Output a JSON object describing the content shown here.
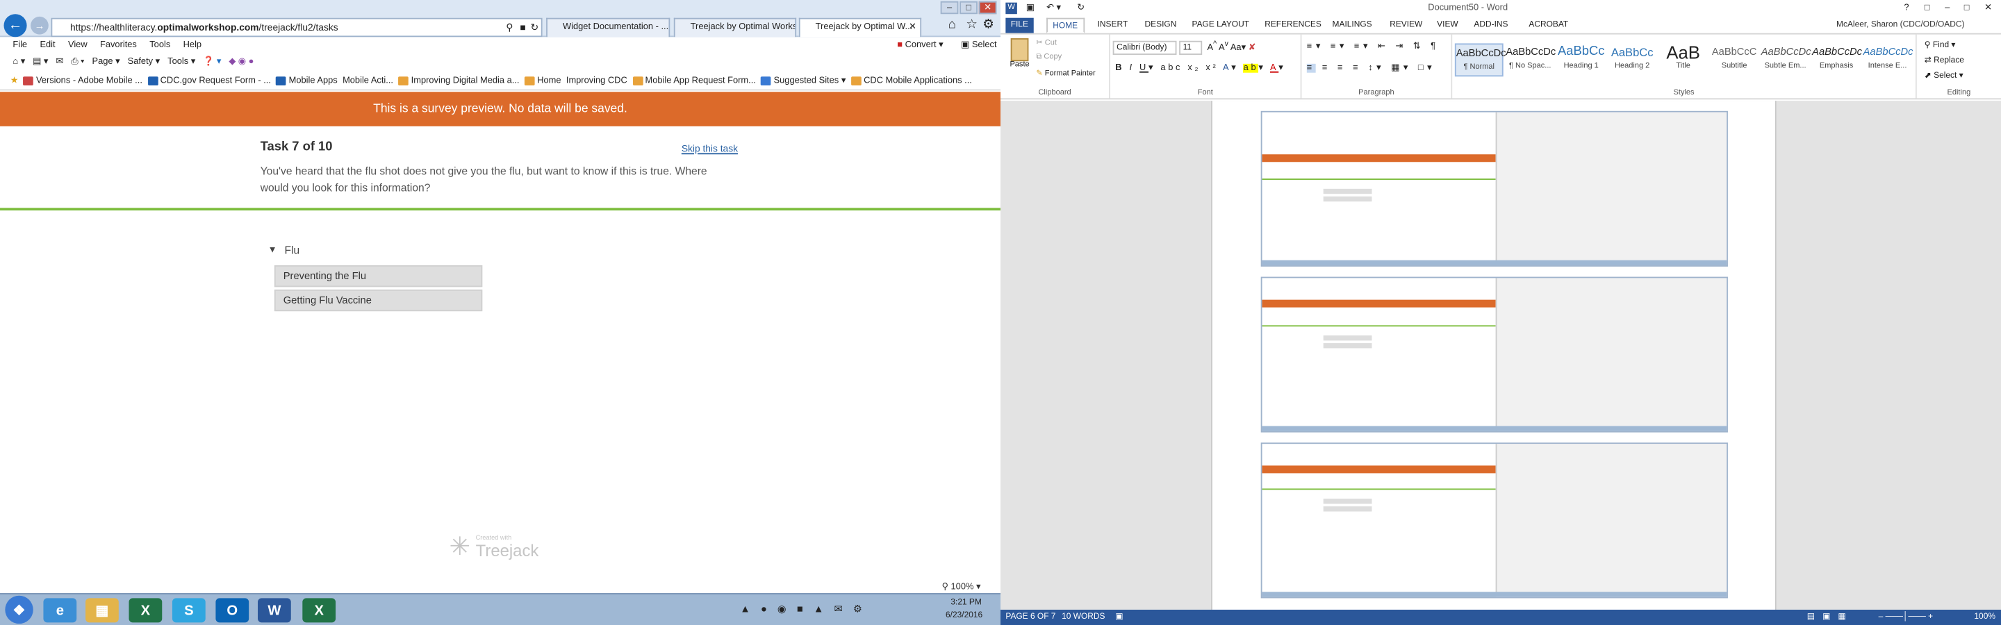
{
  "browser": {
    "address": "https://healthliteracy.optimalworkshop.com/treejack/flu2/tasks",
    "address_parts": {
      "prefix": "https://healthliteracy.",
      "domain": "optimalworkshop.com",
      "suffix": "/treejack/flu2/tasks"
    },
    "tabs": [
      "Widget Documentation - ...",
      "Treejack by Optimal Works...",
      "Treejack by Optimal W..."
    ],
    "menu": [
      "File",
      "Edit",
      "View",
      "Favorites",
      "Tools",
      "Help"
    ],
    "convert_label": "Convert",
    "select_label": "Select",
    "cmd": {
      "page": "Page",
      "safety": "Safety",
      "tools": "Tools"
    },
    "favorites": [
      "Versions - Adobe Mobile ...",
      "CDC.gov Request Form - ...",
      "Mobile Apps",
      "Mobile Acti...",
      "Improving Digital Media a...",
      "Home",
      "Improving CDC",
      "Mobile App Request Form...",
      "Suggested Sites",
      "CDC Mobile Applications ..."
    ],
    "zoom": "100%"
  },
  "survey": {
    "banner": "This is a survey preview. No data will be saved.",
    "task_title": "Task 7 of 10",
    "skip_label": "Skip this task",
    "task_text": "You've heard that the flu shot does not give you the flu, but want to know if this is true. Where would you look for this information?",
    "tree_root": "Flu",
    "tree_items": [
      "Preventing the Flu",
      "Getting Flu Vaccine"
    ],
    "created_with": "Created with",
    "brand": "Treejack"
  },
  "word": {
    "window_title": "Document50 - Word",
    "user": "McAleer, Sharon (CDC/OD/OADC)",
    "tabs": [
      "FILE",
      "HOME",
      "INSERT",
      "DESIGN",
      "PAGE LAYOUT",
      "REFERENCES",
      "MAILINGS",
      "REVIEW",
      "VIEW",
      "ADD-INS",
      "ACROBAT"
    ],
    "clipboard": {
      "paste": "Paste",
      "cut": "Cut",
      "copy": "Copy",
      "format_painter": "Format Painter",
      "label": "Clipboard"
    },
    "font": {
      "name": "Calibri (Body)",
      "size": "11",
      "label": "Font"
    },
    "paragraph_label": "Paragraph",
    "styles_label": "Styles",
    "styles": [
      {
        "preview": "AaBbCcDc",
        "name": "¶ Normal"
      },
      {
        "preview": "AaBbCcDc",
        "name": "¶ No Spac..."
      },
      {
        "preview": "AaBbCc",
        "name": "Heading 1"
      },
      {
        "preview": "AaBbCc",
        "name": "Heading 2"
      },
      {
        "preview": "AaB",
        "name": "Title"
      },
      {
        "preview": "AaBbCcC",
        "name": "Subtitle"
      },
      {
        "preview": "AaBbCcDc",
        "name": "Subtle Em..."
      },
      {
        "preview": "AaBbCcDc",
        "name": "Emphasis"
      },
      {
        "preview": "AaBbCcDc",
        "name": "Intense E..."
      }
    ],
    "editing": {
      "find": "Find",
      "replace": "Replace",
      "select": "Select",
      "label": "Editing"
    },
    "status": {
      "page": "PAGE 6 OF 7",
      "words": "10 WORDS",
      "zoom": "100%"
    }
  },
  "taskbar": {
    "time": "3:21 PM",
    "date": "6/23/2016"
  },
  "colors": {
    "banner": "#dc6a2a",
    "rule": "#7cbd3c",
    "word_blue": "#2b579a",
    "link": "#2a62a3"
  }
}
